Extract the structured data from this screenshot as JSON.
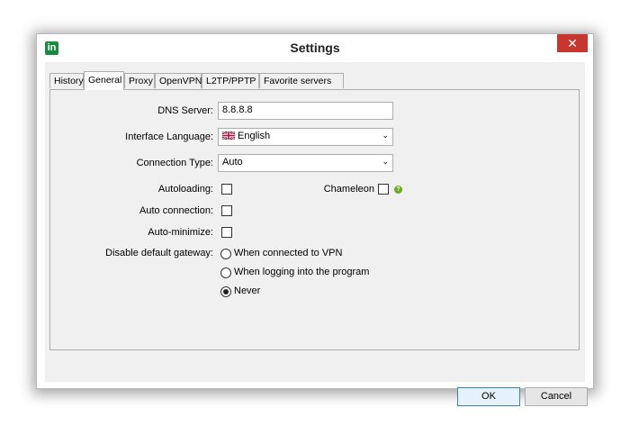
{
  "window": {
    "title": "Settings",
    "app_icon": "in",
    "close_glyph": "✕"
  },
  "tabs": [
    {
      "label": "History"
    },
    {
      "label": "General",
      "active": true
    },
    {
      "label": "Proxy"
    },
    {
      "label": "OpenVPN"
    },
    {
      "label": "L2TP/PPTP"
    },
    {
      "label": "Favorite servers"
    }
  ],
  "form": {
    "dns_label": "DNS Server:",
    "dns_value": "8.8.8.8",
    "language_label": "Interface Language:",
    "language_value": "English",
    "connection_type_label": "Connection Type:",
    "connection_type_value": "Auto",
    "autoloading_label": "Autoloading:",
    "chameleon_label": "Chameleon",
    "auto_connection_label": "Auto connection:",
    "auto_minimize_label": "Auto-minimize:",
    "gateway_label": "Disable default gateway:",
    "gateway_options": [
      {
        "label": "When connected to VPN",
        "selected": false
      },
      {
        "label": "When logging into the program",
        "selected": false
      },
      {
        "label": "Never",
        "selected": true
      }
    ]
  },
  "buttons": {
    "ok": "OK",
    "cancel": "Cancel"
  },
  "colors": {
    "close_button": "#c7372f",
    "app_icon": "#1a8a3e",
    "help_icon": "#6aaa1f"
  }
}
